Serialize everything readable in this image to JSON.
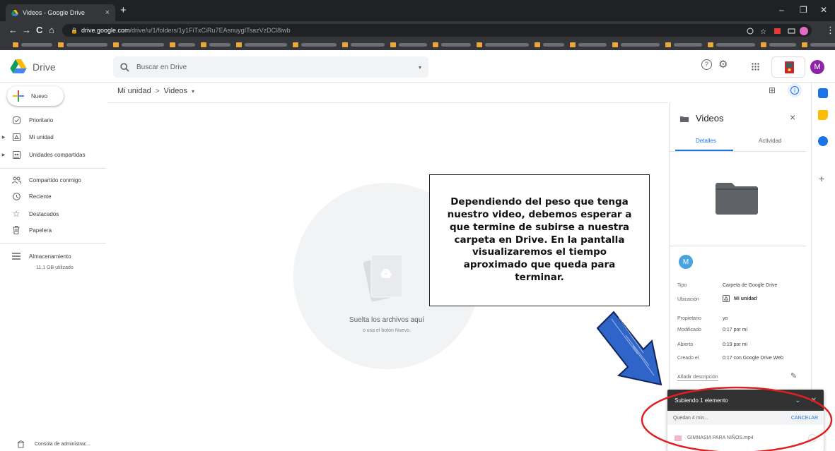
{
  "browser": {
    "tab_title": "Videos - Google Drive",
    "tab_close": "×",
    "new_tab": "+",
    "minimize": "–",
    "restore": "❐",
    "close": "✕",
    "back": "←",
    "forward": "→",
    "reload": "C",
    "home": "⌂",
    "url_host": "drive.google.com",
    "url_path": "/drive/u/1/folders/1y1FiTxCiRu7EAsnuygITsazVzDCl8iwb",
    "menu": "⋮"
  },
  "header": {
    "app_name": "Drive",
    "search_placeholder": "Buscar en Drive",
    "search_dropdown": "▾",
    "help": "?",
    "settings": "⚙",
    "apps": "⋮⋮⋮",
    "account_initial": "M"
  },
  "sidebar": {
    "new_label": "Nuevo",
    "items": [
      {
        "label": "Prioritario"
      },
      {
        "label": "Mi unidad"
      },
      {
        "label": "Unidades compartidas"
      },
      {
        "label": "Compartido conmigo"
      },
      {
        "label": "Reciente"
      },
      {
        "label": "Destacados"
      },
      {
        "label": "Papelera"
      },
      {
        "label": "Almacenamiento"
      }
    ],
    "storage_used": "11,1 GB utilizado",
    "admin_console": "Consola de administrac..."
  },
  "main": {
    "breadcrumb_root": "Mi unidad",
    "breadcrumb_sep": ">",
    "breadcrumb_current": "Videos",
    "breadcrumb_caret": "▾",
    "grid_view": "⊞",
    "info": "i",
    "drop_title": "Suelta los archivos aquí",
    "drop_subtitle": "o usa el botón Nuevo."
  },
  "callout": {
    "text": "Dependiendo del peso que tenga nuestro video, debemos esperar a que termine de subirse a nuestra carpeta en Drive. En la pantalla visualizaremos el tiempo aproximado que queda para terminar."
  },
  "details": {
    "title": "Videos",
    "close": "×",
    "tab_details": "Detalles",
    "tab_activity": "Actividad",
    "owner_initial": "M",
    "properties": [
      {
        "key": "Tipo",
        "value": "Carpeta de Google Drive"
      },
      {
        "key": "Ubicación",
        "value": "Mi unidad"
      },
      {
        "key": "Propietario",
        "value": "yo"
      },
      {
        "key": "Modificado",
        "value": "0:17 por mí"
      },
      {
        "key": "Abierto",
        "value": "0:19 por mí"
      },
      {
        "key": "Creado el",
        "value": "0:17 con Google Drive Web"
      }
    ],
    "add_description": "Añadir descripción",
    "pencil": "✎"
  },
  "upload": {
    "title": "Subiendo 1 elemento",
    "collapse": "⌄",
    "close": "✕",
    "remaining": "Quedan 4 min...",
    "cancel": "CANCELAR",
    "file_name": "GIMNASIA PARA NIÑOS.mp4"
  },
  "rail": {
    "add": "+"
  },
  "colors": {
    "accent_blue": "#1a73e8",
    "avatar_purple": "#8e24aa",
    "owner_avatar": "#4aa3df",
    "annotation_circle": "#e02020",
    "arrow_blue": "#2f64c8"
  },
  "icons": {
    "drive_logo": "drive-logo-icon",
    "search": "search-icon",
    "new_plus": "multicolor-plus-icon",
    "folder": "folder-icon"
  }
}
